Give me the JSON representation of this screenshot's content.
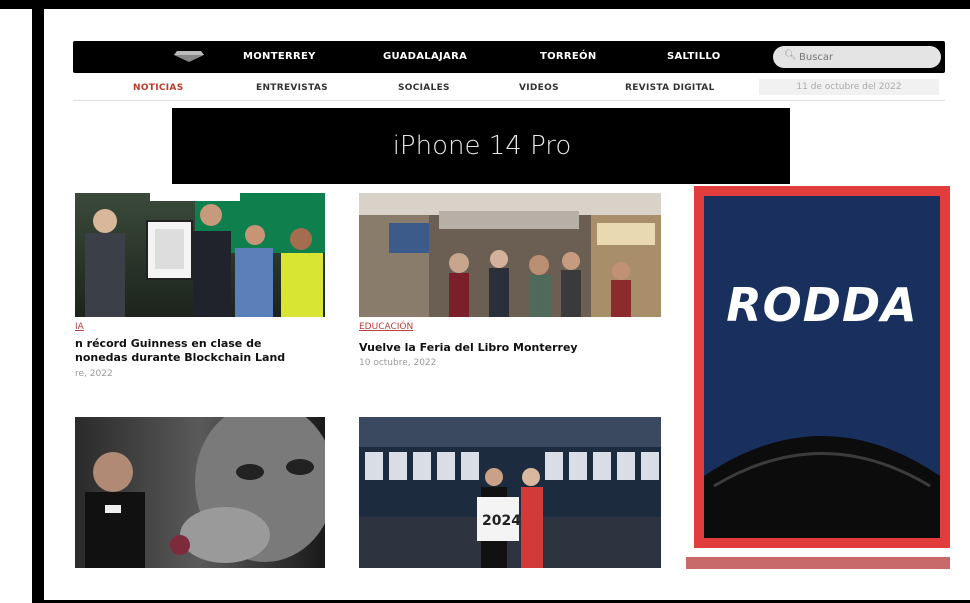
{
  "nav": {
    "cities": [
      "MONTERREY",
      "GUADALAJARA",
      "TORREÓN",
      "SALTILLO"
    ],
    "search_placeholder": "Buscar"
  },
  "subnav": {
    "items": [
      "NOTICIAS",
      "ENTREVISTAS",
      "SOCIALES",
      "VIDEOS",
      "REVISTA DIGITAL"
    ],
    "active_index": 0,
    "date": "11 de octubre del 2022"
  },
  "banner": {
    "apple_glyph": "",
    "text": "iPhone 14 Pro"
  },
  "articles": [
    {
      "category": "IA",
      "title_line1": "n récord Guinness en clase de",
      "title_line2": "nonedas durante Blockchain Land",
      "date": "re, 2022"
    },
    {
      "category": "EDUCACIÓN",
      "title_line1": "Vuelve la Feria del Libro Monterrey",
      "title_line2": "",
      "date": "10 octubre, 2022"
    }
  ],
  "ad": {
    "brand": "RODDA"
  },
  "colors": {
    "accent": "#c0392b",
    "ad_frame": "#e23d3d",
    "ad_bg": "#19305e"
  }
}
